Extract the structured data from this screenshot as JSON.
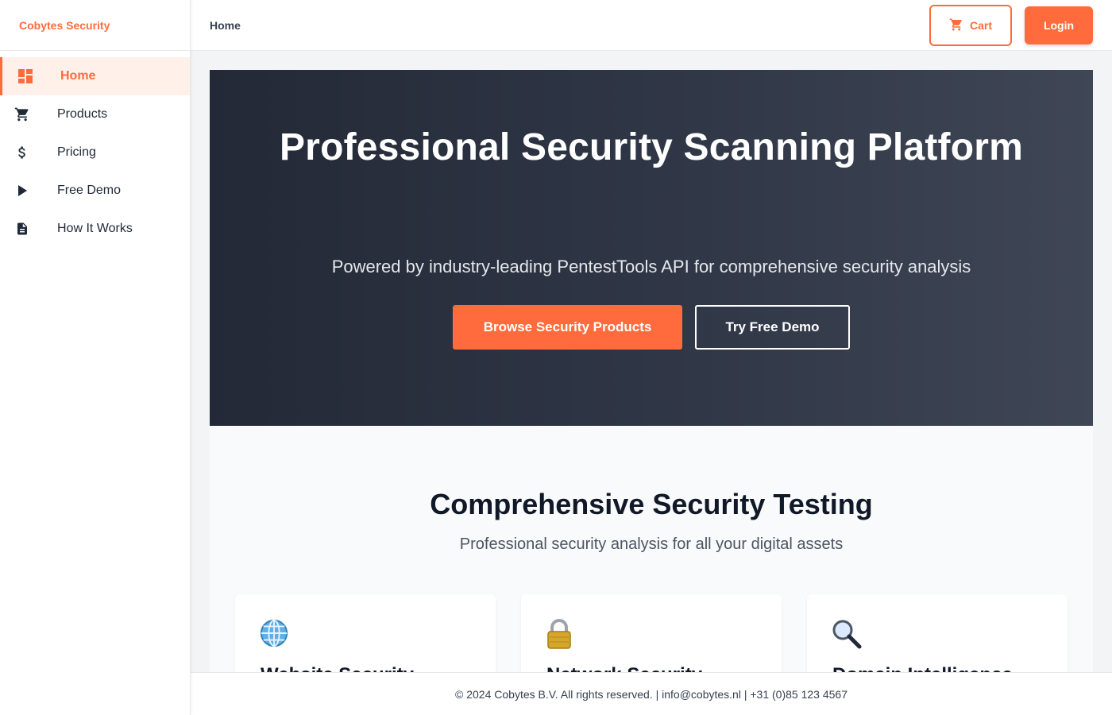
{
  "brand": {
    "name": "Cobytes Security",
    "accent_color": "#ff6b3d"
  },
  "sidebar": {
    "items": [
      {
        "label": "Home",
        "icon": "dashboard-icon",
        "active": true
      },
      {
        "label": "Products",
        "icon": "cart-icon"
      },
      {
        "label": "Pricing",
        "icon": "dollar-icon"
      },
      {
        "label": "Free Demo",
        "icon": "play-icon"
      },
      {
        "label": "How It Works",
        "icon": "document-icon"
      }
    ]
  },
  "header": {
    "breadcrumb": "Home",
    "cart_label": "Cart",
    "cart_icon": "cart-icon",
    "login_label": "Login"
  },
  "hero": {
    "title": "Professional Security Scanning Platform",
    "subtitle": "Powered by industry-leading PentestTools API for comprehensive security analysis",
    "primary_button": "Browse Security Products",
    "secondary_button": "Try Free Demo"
  },
  "features": {
    "title": "Comprehensive Security Testing",
    "subtitle": "Professional security analysis for all your digital assets",
    "cards": [
      {
        "icon": "globe-icon",
        "title": "Website Security"
      },
      {
        "icon": "lock-icon",
        "title": "Network Security"
      },
      {
        "icon": "magnifier-icon",
        "title": "Domain Intelligence"
      }
    ]
  },
  "footer": {
    "text": "© 2024 Cobytes B.V. All rights reserved. | info@cobytes.nl | +31 (0)85 123 4567"
  }
}
